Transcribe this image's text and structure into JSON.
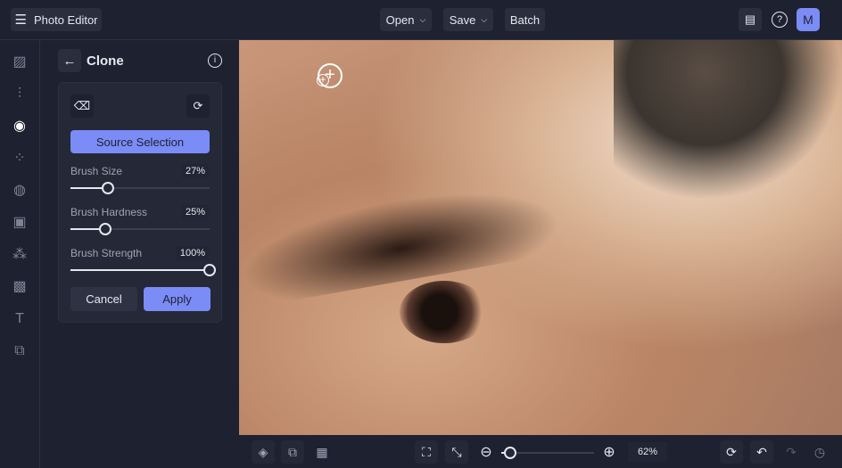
{
  "header": {
    "app_title": "Photo Editor",
    "open": "Open",
    "save": "Save",
    "batch": "Batch",
    "avatar": "M"
  },
  "panel": {
    "title": "Clone",
    "source_selection": "Source Selection",
    "sliders": [
      {
        "label": "Brush Size",
        "value": "27%",
        "percent": 27
      },
      {
        "label": "Brush Hardness",
        "value": "25%",
        "percent": 25
      },
      {
        "label": "Brush Strength",
        "value": "100%",
        "percent": 100
      }
    ],
    "cancel": "Cancel",
    "apply": "Apply"
  },
  "zoom": {
    "value": "62%",
    "percent": 10
  },
  "colors": {
    "accent": "#7b8cf7",
    "bg": "#1e2130"
  }
}
